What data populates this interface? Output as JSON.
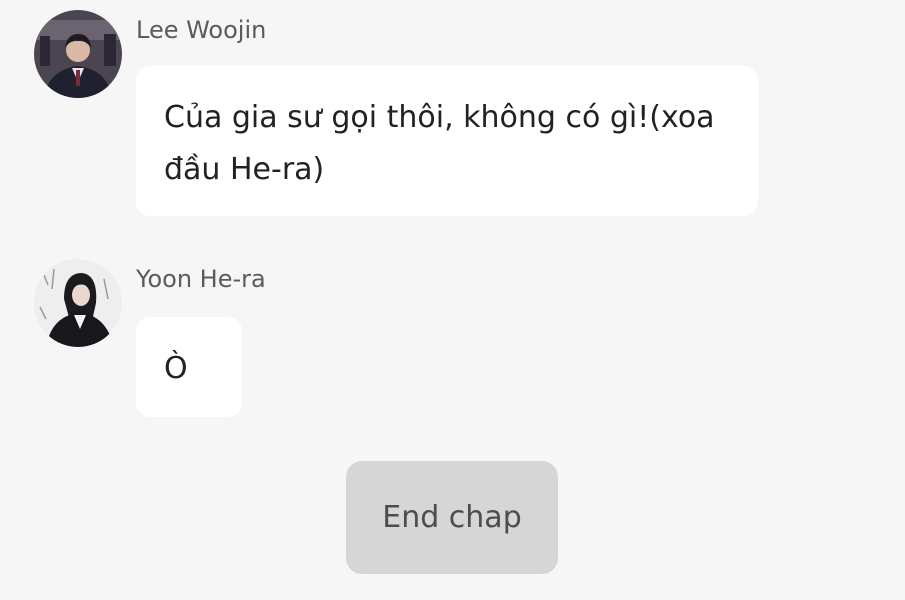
{
  "messages": [
    {
      "sender": "Lee Woojin",
      "text": "Của gia sư gọi thôi, không có gì!(xoa đầu He-ra)",
      "avatar_icon": "male-student-avatar"
    },
    {
      "sender": "Yoon He-ra",
      "text": "Ò",
      "avatar_icon": "female-student-avatar"
    }
  ],
  "end_button": {
    "label": "End chap"
  },
  "colors": {
    "background": "#f6f6f6",
    "bubble": "#ffffff",
    "button": "#d6d6d6",
    "name_text": "#5b5b5b",
    "message_text": "#222222"
  }
}
